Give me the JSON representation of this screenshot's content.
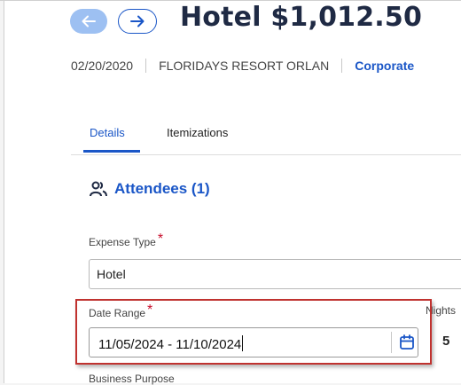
{
  "header": {
    "title": "Hotel $1,012.50",
    "prev_icon": "arrow-left-icon",
    "next_icon": "arrow-right-icon"
  },
  "meta": {
    "date": "02/20/2020",
    "vendor": "FLORIDAYS RESORT ORLAN",
    "payment": "Corporate"
  },
  "tabs": [
    {
      "label": "Details",
      "active": true
    },
    {
      "label": "Itemizations",
      "active": false
    }
  ],
  "attendees": {
    "label": "Attendees (1)",
    "icon": "people-icon"
  },
  "fields": {
    "expense_type": {
      "label": "Expense Type",
      "required_mark": "*",
      "value": "Hotel"
    },
    "date_range": {
      "label": "Date Range",
      "required_mark": "*",
      "value": "11/05/2024 - 11/10/2024",
      "icon": "calendar-icon"
    },
    "nights": {
      "label": "Nights",
      "value": "5"
    },
    "business_purpose": {
      "label": "Business Purpose"
    }
  },
  "colors": {
    "accent": "#1a56c7",
    "required": "#c8102e",
    "highlight": "#c0322f",
    "title": "#1f2a44"
  }
}
